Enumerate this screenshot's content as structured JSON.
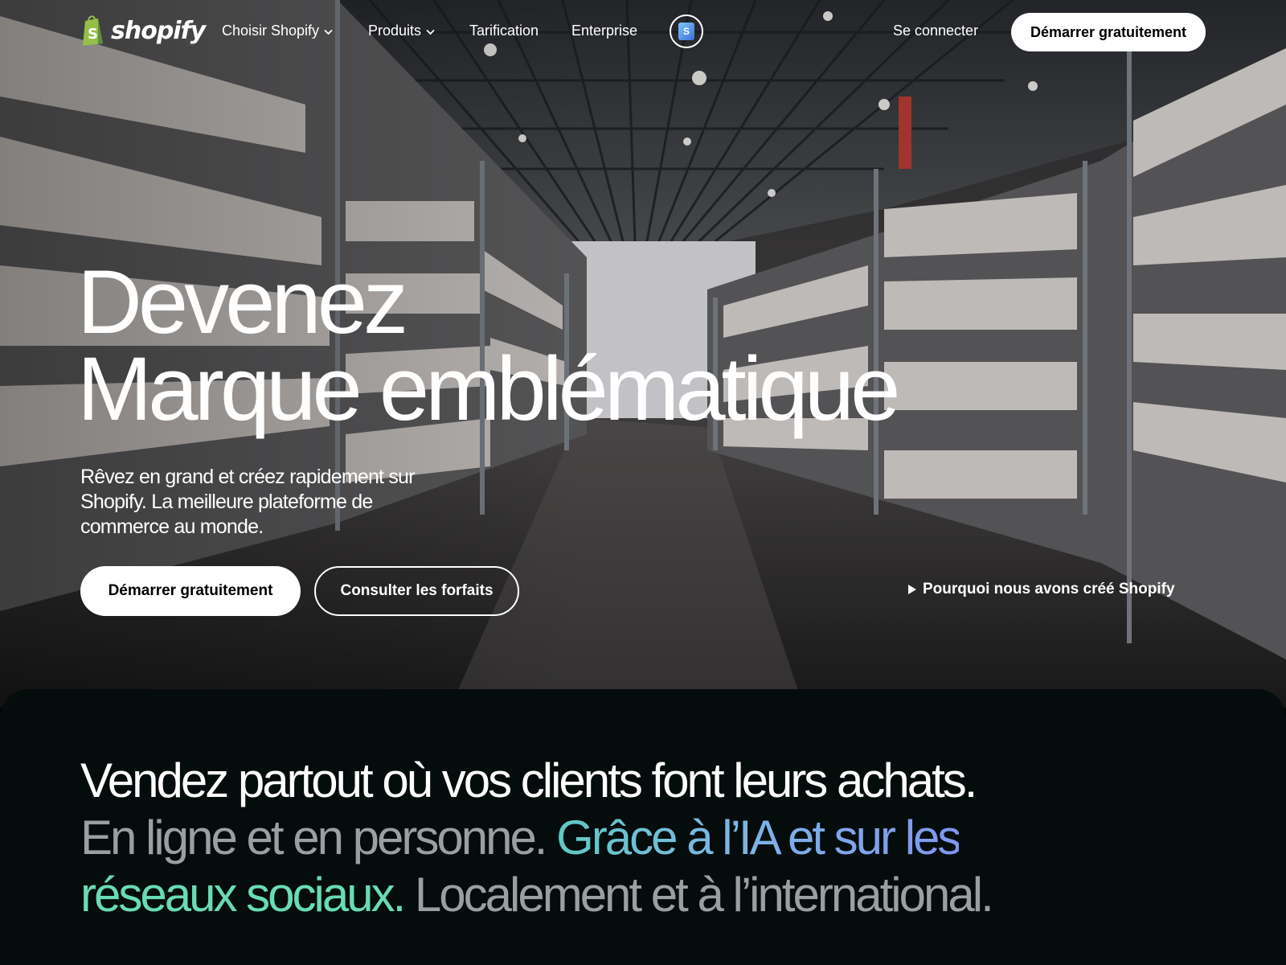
{
  "nav": {
    "brand": "shopify",
    "items": [
      {
        "label": "Choisir Shopify",
        "dropdown": true
      },
      {
        "label": "Produits",
        "dropdown": true
      },
      {
        "label": "Tarification",
        "dropdown": false
      },
      {
        "label": "Enterprise",
        "dropdown": false
      }
    ],
    "shop_icon": "shop-bag-icon",
    "login": "Se connecter",
    "cta": "Démarrer gratuitement"
  },
  "hero": {
    "title_line1": "Devenez",
    "title_line2": "Marque emblématique",
    "subtitle": "Rêvez en grand et créez rapidement sur Shopify. La meilleure plateforme de commerce au monde.",
    "primary_cta": "Démarrer gratuitement",
    "secondary_cta": "Consulter les forfaits",
    "video_link": "Pourquoi nous avons créé Shopify",
    "video_icon": "play-icon"
  },
  "section": {
    "line1": "Vendez partout où vos clients font leurs achats.",
    "part_grey1": "En ligne et en personne. ",
    "part_gradient": "Grâce à l’IA et sur les",
    "part_green": "réseaux sociaux.",
    "part_grey2": " Localement et à l’international."
  },
  "colors": {
    "brand_green": "#95bf47",
    "section_bg": "#050c0c",
    "text_grey": "#9b9ea3",
    "accent_teal": "#5fc9c3",
    "accent_blue": "#7f96f0",
    "accent_green": "#68dcb4"
  }
}
